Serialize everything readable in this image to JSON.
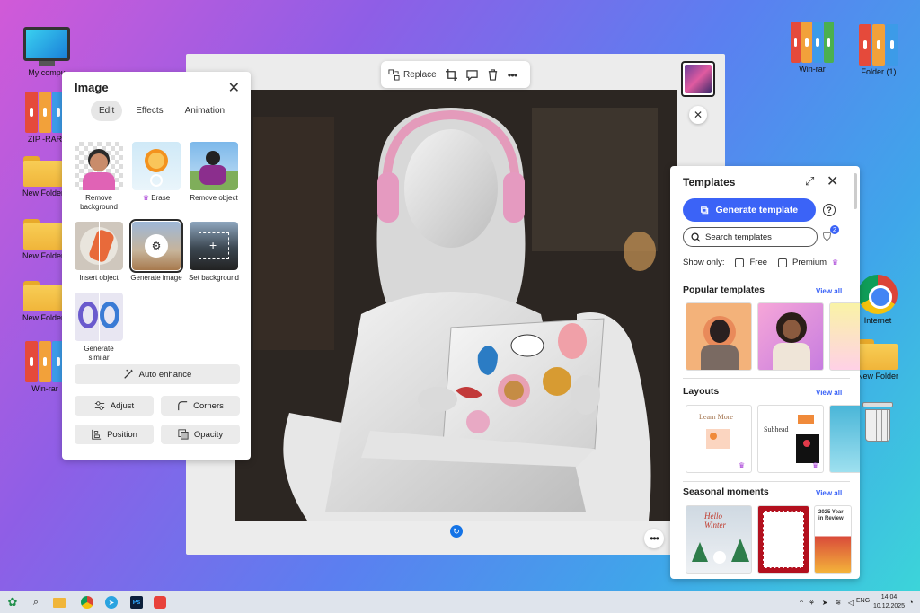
{
  "desktop": {
    "icons_left": [
      {
        "label": "My compu",
        "kind": "monitor"
      },
      {
        "label": "ZIP -RAR",
        "kind": "binders"
      },
      {
        "label": "New Folder",
        "kind": "folder"
      },
      {
        "label": "New Folder",
        "kind": "folder"
      },
      {
        "label": "New Folder",
        "kind": "folder"
      },
      {
        "label": "Win-rar",
        "kind": "binders"
      }
    ],
    "icons_right": [
      {
        "label": "Win-rar",
        "kind": "binders"
      },
      {
        "label": "Folder (1)",
        "kind": "binders"
      },
      {
        "label": "Internet",
        "kind": "chrome"
      },
      {
        "label": "New Folder",
        "kind": "folder"
      },
      {
        "label": "",
        "kind": "trash"
      }
    ]
  },
  "canvas_toolbar": {
    "replace_label": "Replace",
    "icons": [
      "crop-icon",
      "comment-icon",
      "delete-icon",
      "more-icon"
    ]
  },
  "image_panel": {
    "title": "Image",
    "tabs": [
      {
        "label": "Edit",
        "active": true
      },
      {
        "label": "Effects",
        "active": false
      },
      {
        "label": "Animation",
        "active": false
      }
    ],
    "tools": [
      {
        "label": "Remove background"
      },
      {
        "label": "Erase",
        "premium": true
      },
      {
        "label": "Remove object"
      },
      {
        "label": "Insert object"
      },
      {
        "label": "Generate image",
        "selected": true
      },
      {
        "label": "Set background"
      },
      {
        "label": "Generate similar"
      }
    ],
    "auto_enhance": "Auto enhance",
    "buttons": {
      "adjust": "Adjust",
      "corners": "Corners",
      "position": "Position",
      "opacity": "Opacity"
    }
  },
  "templates_panel": {
    "title": "Templates",
    "generate_label": "Generate template",
    "help": "?",
    "search_placeholder": "Search templates",
    "filter_count": "2",
    "show_only_label": "Show only:",
    "free_label": "Free",
    "premium_label": "Premium",
    "sections": [
      {
        "title": "Popular templates",
        "view_all": "View all"
      },
      {
        "title": "Layouts",
        "view_all": "View all"
      },
      {
        "title": "Seasonal moments",
        "view_all": "View all"
      }
    ],
    "layout_cards": [
      "Learn More",
      "Subhead"
    ],
    "seasonal_cards": [
      "Hello Winter",
      "2025 Year in Review"
    ]
  },
  "taskbar": {
    "lang": "ENG",
    "time": "14:04",
    "date": "10.12.2025"
  },
  "colors": {
    "accent": "#3b63f7",
    "premium": "#a73dd6"
  }
}
